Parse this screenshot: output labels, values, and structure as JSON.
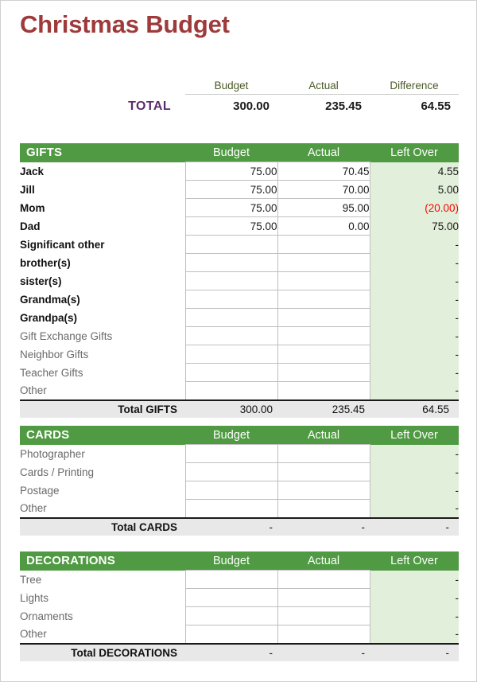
{
  "document": {
    "title": "Christmas Budget"
  },
  "summary": {
    "headers": {
      "budget": "Budget",
      "actual": "Actual",
      "difference": "Difference"
    },
    "total_label": "TOTAL",
    "budget": "300.00",
    "actual": "235.45",
    "difference": "64.55"
  },
  "colors": {
    "title": "#9E3A3A",
    "total_label": "#5B2C6F",
    "section_header_bg": "#4F9A42",
    "leftover_bg": "#E2EFDA",
    "total_row_bg": "#E8E8E8",
    "negative": "#FF0000",
    "summary_header_text": "#4A5A28"
  },
  "column_headers": {
    "budget": "Budget",
    "actual": "Actual",
    "left_over": "Left Over"
  },
  "sections": [
    {
      "name": "GIFTS",
      "total_label": "Total GIFTS",
      "total": {
        "budget": "300.00",
        "actual": "235.45",
        "left_over": "64.55",
        "left_over_negative": false
      },
      "rows": [
        {
          "label": "Jack",
          "bold": true,
          "budget": "75.00",
          "actual": "70.45",
          "left_over": "4.55",
          "left_over_negative": false
        },
        {
          "label": "Jill",
          "bold": true,
          "budget": "75.00",
          "actual": "70.00",
          "left_over": "5.00",
          "left_over_negative": false
        },
        {
          "label": "Mom",
          "bold": true,
          "budget": "75.00",
          "actual": "95.00",
          "left_over": "(20.00)",
          "left_over_negative": true
        },
        {
          "label": "Dad",
          "bold": true,
          "budget": "75.00",
          "actual": "0.00",
          "left_over": "75.00",
          "left_over_negative": false
        },
        {
          "label": "Significant other",
          "bold": true,
          "budget": "",
          "actual": "",
          "left_over": "-",
          "left_over_negative": false
        },
        {
          "label": "brother(s)",
          "bold": true,
          "budget": "",
          "actual": "",
          "left_over": "-",
          "left_over_negative": false
        },
        {
          "label": "sister(s)",
          "bold": true,
          "budget": "",
          "actual": "",
          "left_over": "-",
          "left_over_negative": false
        },
        {
          "label": "Grandma(s)",
          "bold": true,
          "budget": "",
          "actual": "",
          "left_over": "-",
          "left_over_negative": false
        },
        {
          "label": "Grandpa(s)",
          "bold": true,
          "budget": "",
          "actual": "",
          "left_over": "-",
          "left_over_negative": false
        },
        {
          "label": "Gift Exchange Gifts",
          "bold": false,
          "budget": "",
          "actual": "",
          "left_over": "-",
          "left_over_negative": false
        },
        {
          "label": "Neighbor Gifts",
          "bold": false,
          "budget": "",
          "actual": "",
          "left_over": "-",
          "left_over_negative": false
        },
        {
          "label": "Teacher Gifts",
          "bold": false,
          "budget": "",
          "actual": "",
          "left_over": "-",
          "left_over_negative": false
        },
        {
          "label": "Other",
          "bold": false,
          "budget": "",
          "actual": "",
          "left_over": "-",
          "left_over_negative": false
        }
      ]
    },
    {
      "name": "CARDS",
      "total_label": "Total CARDS",
      "total": {
        "budget": "-",
        "actual": "-",
        "left_over": "-",
        "left_over_negative": false
      },
      "rows": [
        {
          "label": "Photographer",
          "bold": false,
          "budget": "",
          "actual": "",
          "left_over": "-",
          "left_over_negative": false
        },
        {
          "label": "Cards / Printing",
          "bold": false,
          "budget": "",
          "actual": "",
          "left_over": "-",
          "left_over_negative": false
        },
        {
          "label": "Postage",
          "bold": false,
          "budget": "",
          "actual": "",
          "left_over": "-",
          "left_over_negative": false
        },
        {
          "label": "Other",
          "bold": false,
          "budget": "",
          "actual": "",
          "left_over": "-",
          "left_over_negative": false
        }
      ]
    },
    {
      "name": "DECORATIONS",
      "total_label": "Total DECORATIONS",
      "total": {
        "budget": "-",
        "actual": "-",
        "left_over": "-",
        "left_over_negative": false
      },
      "rows": [
        {
          "label": "Tree",
          "bold": false,
          "budget": "",
          "actual": "",
          "left_over": "-",
          "left_over_negative": false
        },
        {
          "label": "Lights",
          "bold": false,
          "budget": "",
          "actual": "",
          "left_over": "-",
          "left_over_negative": false
        },
        {
          "label": "Ornaments",
          "bold": false,
          "budget": "",
          "actual": "",
          "left_over": "-",
          "left_over_negative": false
        },
        {
          "label": "Other",
          "bold": false,
          "budget": "",
          "actual": "",
          "left_over": "-",
          "left_over_negative": false
        }
      ]
    }
  ],
  "layout": {
    "section_tops": [
      179,
      534,
      692
    ]
  }
}
